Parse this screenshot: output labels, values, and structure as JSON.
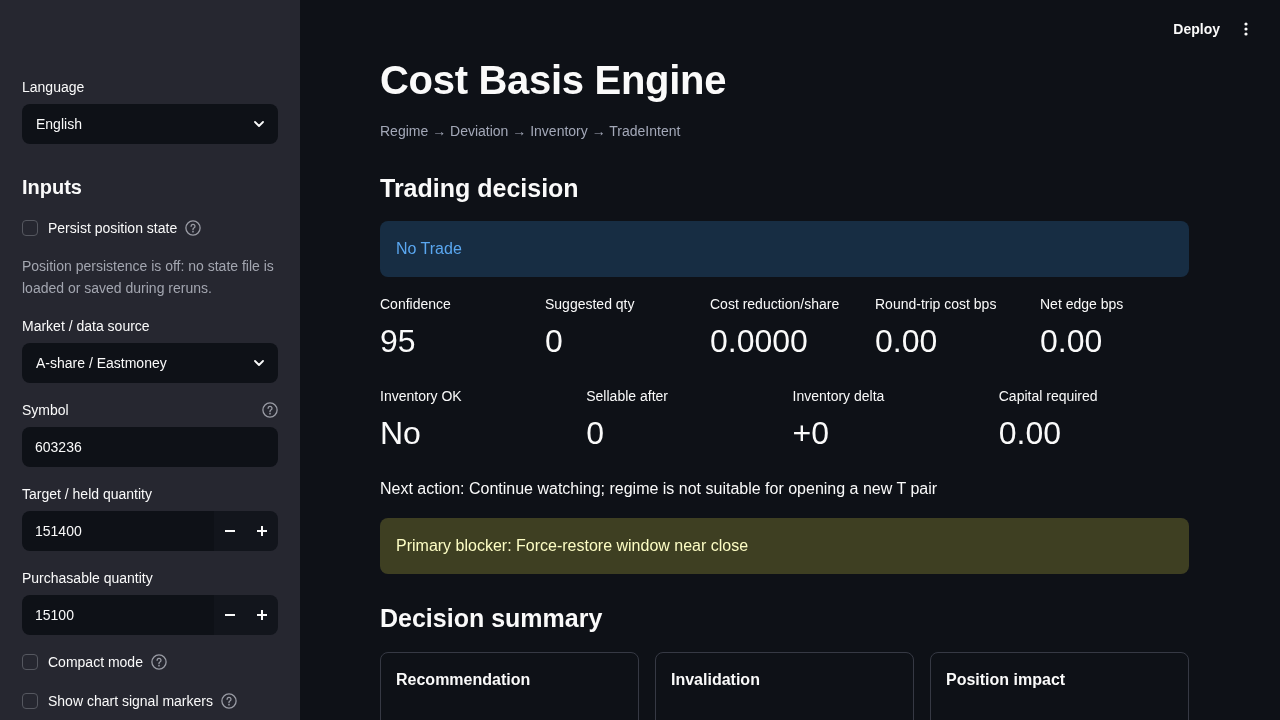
{
  "toolbar": {
    "deploy_label": "Deploy"
  },
  "sidebar": {
    "items": [
      {
        "kind": "select",
        "label": "Language",
        "value": "English"
      },
      {
        "kind": "heading",
        "text": "Inputs"
      },
      {
        "kind": "checkbox",
        "label": "Persist position state",
        "checked": false,
        "help": true
      },
      {
        "kind": "caption",
        "text": "Position persistence is off: no state file is loaded or saved during reruns."
      },
      {
        "kind": "select",
        "label": "Market / data source",
        "value": "A-share / Eastmoney"
      },
      {
        "kind": "text_input",
        "label": "Symbol",
        "value": "603236",
        "help": true
      },
      {
        "kind": "number_input",
        "label": "Target / held quantity",
        "value": "151400"
      },
      {
        "kind": "number_input",
        "label": "Purchasable quantity",
        "value": "15100"
      },
      {
        "kind": "checkbox",
        "label": "Compact mode",
        "checked": false,
        "help": true
      },
      {
        "kind": "checkbox",
        "label": "Show chart signal markers",
        "checked": false,
        "help": true
      }
    ]
  },
  "title": "Cost Basis Engine",
  "breadcrumb": "Regime → Deviation → Inventory → TradeIntent",
  "trading_decision": {
    "heading": "Trading decision",
    "status": {
      "kind": "info",
      "text": "No Trade"
    },
    "metric_rows": [
      [
        {
          "label": "Confidence",
          "value": "95"
        },
        {
          "label": "Suggested qty",
          "value": "0"
        },
        {
          "label": "Cost reduction/share",
          "value": "0.0000"
        },
        {
          "label": "Round-trip cost bps",
          "value": "0.00"
        },
        {
          "label": "Net edge bps",
          "value": "0.00"
        }
      ],
      [
        {
          "label": "Inventory OK",
          "value": "No"
        },
        {
          "label": "Sellable after",
          "value": "0"
        },
        {
          "label": "Inventory delta",
          "value": "+0"
        },
        {
          "label": "Capital required",
          "value": "0.00"
        }
      ]
    ],
    "next_action": "Next action: Continue watching; regime is not suitable for opening a new T pair",
    "blocker": {
      "kind": "warning",
      "text": "Primary blocker: Force-restore window near close"
    }
  },
  "decision_summary": {
    "heading": "Decision summary",
    "cards": [
      {
        "title": "Recommendation"
      },
      {
        "title": "Invalidation"
      },
      {
        "title": "Position impact"
      }
    ]
  }
}
